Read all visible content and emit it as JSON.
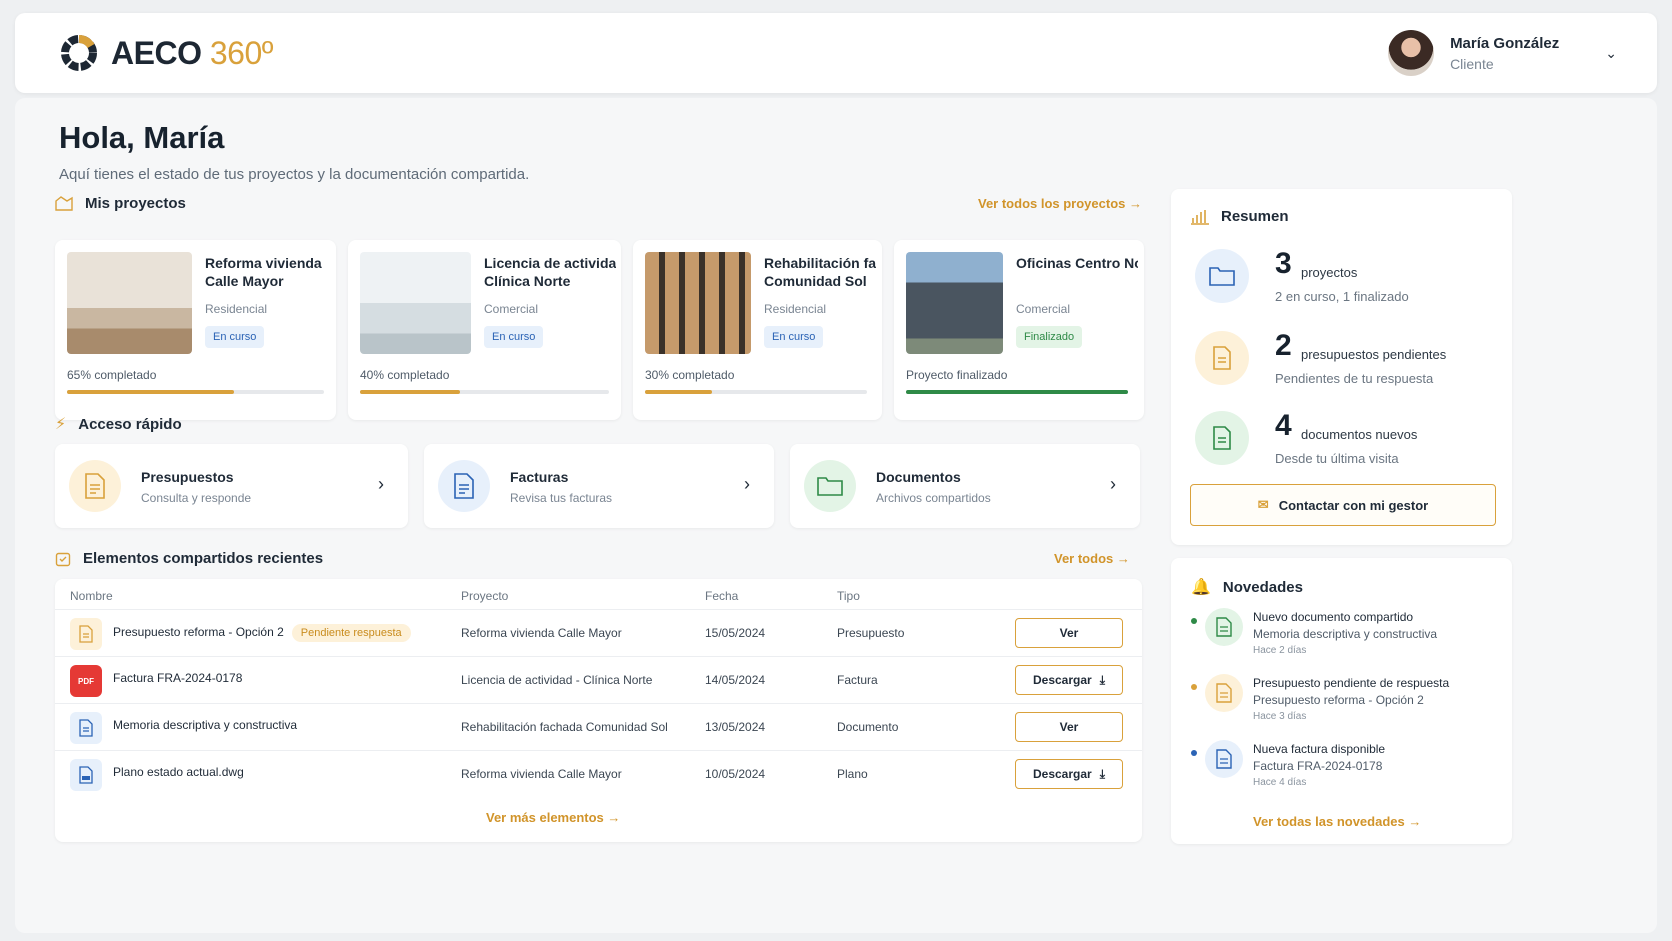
{
  "brand": {
    "name": "AECO",
    "suffix": "360º"
  },
  "user": {
    "name": "María González",
    "role": "Cliente"
  },
  "greeting": {
    "title": "Hola, María",
    "subtitle": "Aquí tienes el estado de tus proyectos y la documentación compartida."
  },
  "projects_section": {
    "title": "Mis proyectos",
    "link": "Ver todos los proyectos →"
  },
  "projects": [
    {
      "title1": "Reforma vivienda",
      "title2": "Calle Mayor",
      "type": "Residencial",
      "status": "En curso",
      "progress_label": "65% completado",
      "progress": 0.65
    },
    {
      "title1": "Licencia de actividad -",
      "title2": "Clínica Norte",
      "type": "Comercial",
      "status": "En curso",
      "progress_label": "40% completado",
      "progress": 0.4
    },
    {
      "title1": "Rehabilitación fachada",
      "title2": "Comunidad Sol",
      "type": "Residencial",
      "status": "En curso",
      "progress_label": "30% completado",
      "progress": 0.3
    },
    {
      "title1": "Oficinas Centro Norte",
      "title2": "",
      "type": "Comercial",
      "status": "Finalizado",
      "progress_label": "Proyecto finalizado",
      "progress": 1.0
    }
  ],
  "quick_access": {
    "title": "Acceso rápido",
    "items": [
      {
        "title": "Presupuestos",
        "subtitle": "Consulta y responde"
      },
      {
        "title": "Facturas",
        "subtitle": "Revisa tus facturas"
      },
      {
        "title": "Documentos",
        "subtitle": "Archivos compartidos"
      }
    ]
  },
  "shared": {
    "title": "Elementos compartidos recientes",
    "link": "Ver todos →",
    "columns": [
      "Nombre",
      "Proyecto",
      "Fecha",
      "Tipo"
    ],
    "rows": [
      {
        "name": "Presupuesto reforma - Opción 2",
        "badge": "Pendiente respuesta",
        "project": "Reforma vivienda Calle Mayor",
        "date": "15/05/2024",
        "type": "Presupuesto",
        "action": "Ver"
      },
      {
        "name": "Factura FRA-2024-0178",
        "badge": "",
        "project": "Licencia de actividad - Clínica Norte",
        "date": "14/05/2024",
        "type": "Factura",
        "action": "Descargar"
      },
      {
        "name": "Memoria descriptiva y constructiva",
        "badge": "",
        "project": "Rehabilitación fachada Comunidad Sol",
        "date": "13/05/2024",
        "type": "Documento",
        "action": "Ver"
      },
      {
        "name": "Plano estado actual.dwg",
        "badge": "",
        "project": "Reforma vivienda Calle Mayor",
        "date": "10/05/2024",
        "type": "Plano",
        "action": "Descargar"
      }
    ],
    "more": "Ver más elementos →"
  },
  "summary": {
    "title": "Resumen",
    "items": [
      {
        "num": "3",
        "label": "proyectos",
        "sub": "2 en curso, 1 finalizado"
      },
      {
        "num": "2",
        "label": "presupuestos pendientes",
        "sub": "Pendientes de tu respuesta"
      },
      {
        "num": "4",
        "label": "documentos nuevos",
        "sub": "Desde tu última visita"
      }
    ],
    "contact": "Contactar con mi gestor"
  },
  "news": {
    "title": "Novedades",
    "items": [
      {
        "title": "Nuevo documento compartido",
        "subtitle": "Memoria descriptiva y constructiva",
        "when": "Hace 2 días"
      },
      {
        "title": "Presupuesto pendiente de respuesta",
        "subtitle": "Presupuesto reforma - Opción 2",
        "when": "Hace 3 días"
      },
      {
        "title": "Nueva factura disponible",
        "subtitle": "Factura FRA-2024-0178",
        "when": "Hace 4 días"
      }
    ],
    "link": "Ver todas las novedades →"
  },
  "colors": {
    "accent": "#d9a13b",
    "blue": "#2b63b5",
    "green": "#2e8a47"
  }
}
